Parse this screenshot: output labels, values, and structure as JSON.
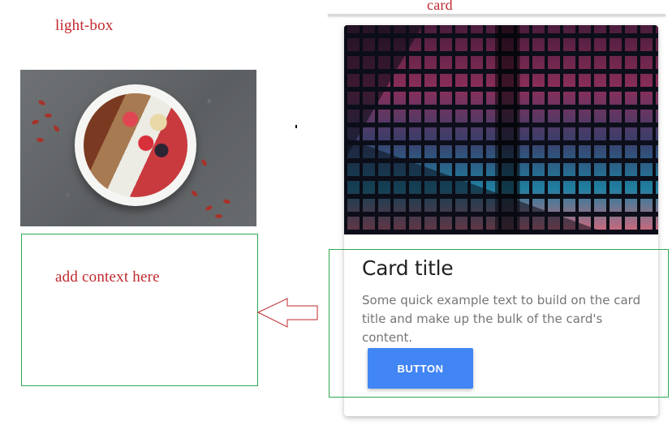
{
  "annotations": {
    "lightbox_label": "light-box",
    "card_label": "card",
    "context_placeholder": "add context here"
  },
  "lightbox": {
    "image": "fruit-bowl-photo"
  },
  "card": {
    "image": "night-building-photo",
    "title": "Card title",
    "text": "Some quick example text to build on the card title and make up the bulk of the card's content.",
    "button_label": "BUTTON"
  },
  "colors": {
    "annotation_red": "#c0282d",
    "outline_green": "#2fa84f",
    "button_blue": "#4285f4"
  }
}
